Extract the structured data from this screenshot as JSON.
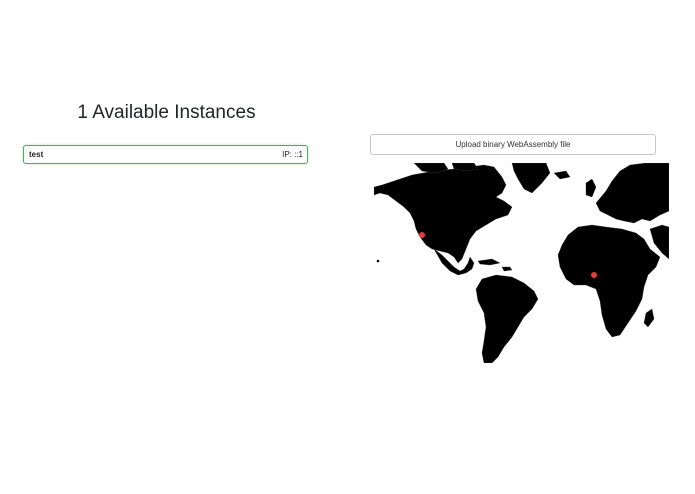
{
  "page": {
    "heading": "1 Available Instances"
  },
  "instances": [
    {
      "name": "test",
      "ip": "IP: ::1"
    }
  ],
  "upload": {
    "label": "Upload binary WebAssembly file"
  },
  "map": {
    "land_color": "#000000",
    "border_color": "#3a3a3a",
    "marker_color": "#e53935",
    "markers": [
      "North America west coast",
      "Central Africa"
    ]
  },
  "colors": {
    "instance_border": "#4caf50"
  }
}
